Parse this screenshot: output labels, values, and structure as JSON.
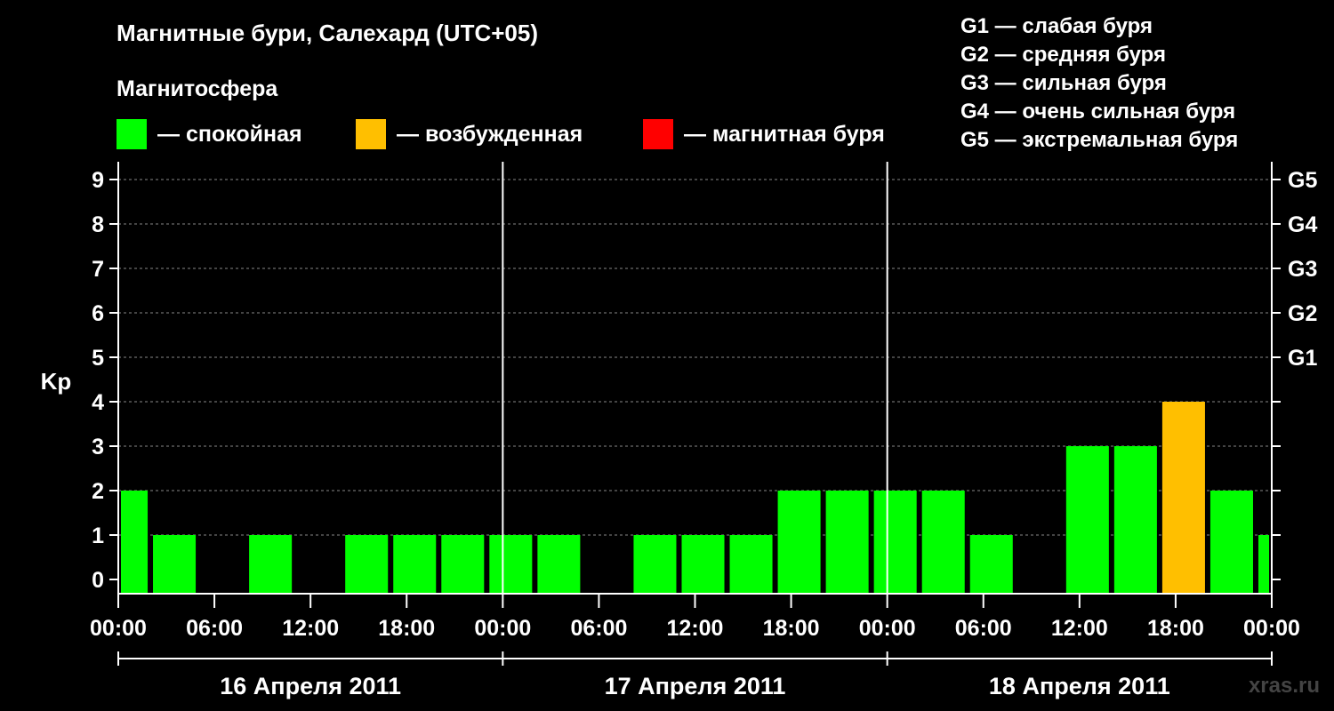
{
  "title": "Магнитные бури, Салехард (UTC+05)",
  "subtitle": "Магнитосфера",
  "legend": [
    {
      "color": "#00ff00",
      "label": "— спокойная"
    },
    {
      "color": "#ffbf00",
      "label": "— возбужденная"
    },
    {
      "color": "#ff0000",
      "label": "— магнитная буря"
    }
  ],
  "storm_scale": [
    "G1 — слабая буря",
    "G2 — средняя буря",
    "G3 — сильная буря",
    "G4 — очень сильная буря",
    "G5 — экстремальная буря"
  ],
  "watermark": "xras.ru",
  "chart_data": {
    "type": "bar",
    "ylabel": "Kp",
    "ylim": [
      0,
      9
    ],
    "yticks": [
      "0",
      "1",
      "2",
      "3",
      "4",
      "5",
      "6",
      "7",
      "8",
      "9"
    ],
    "g_levels": [
      {
        "value": 5,
        "label": "G1"
      },
      {
        "value": 6,
        "label": "G2"
      },
      {
        "value": 7,
        "label": "G3"
      },
      {
        "value": 8,
        "label": "G4"
      },
      {
        "value": 9,
        "label": "G5"
      }
    ],
    "xlim_hours": [
      0,
      72
    ],
    "xticks": [
      "00:00",
      "06:00",
      "12:00",
      "18:00",
      "00:00",
      "06:00",
      "12:00",
      "18:00",
      "00:00",
      "06:00",
      "12:00",
      "18:00",
      "00:00"
    ],
    "days": [
      "16 Апреля 2011",
      "17 Апреля 2011",
      "18 Апреля 2011"
    ],
    "bars": [
      {
        "start_hour": 0,
        "end_hour": 2,
        "kp": 2,
        "color": "#00ff00"
      },
      {
        "start_hour": 2,
        "end_hour": 5,
        "kp": 1,
        "color": "#00ff00"
      },
      {
        "start_hour": 5,
        "end_hour": 8,
        "kp": 0,
        "color": "#00ff00"
      },
      {
        "start_hour": 8,
        "end_hour": 11,
        "kp": 1,
        "color": "#00ff00"
      },
      {
        "start_hour": 11,
        "end_hour": 14,
        "kp": 0,
        "color": "#00ff00"
      },
      {
        "start_hour": 14,
        "end_hour": 17,
        "kp": 1,
        "color": "#00ff00"
      },
      {
        "start_hour": 17,
        "end_hour": 20,
        "kp": 1,
        "color": "#00ff00"
      },
      {
        "start_hour": 20,
        "end_hour": 23,
        "kp": 1,
        "color": "#00ff00"
      },
      {
        "start_hour": 23,
        "end_hour": 26,
        "kp": 1,
        "color": "#00ff00"
      },
      {
        "start_hour": 26,
        "end_hour": 29,
        "kp": 1,
        "color": "#00ff00"
      },
      {
        "start_hour": 29,
        "end_hour": 32,
        "kp": 0,
        "color": "#00ff00"
      },
      {
        "start_hour": 32,
        "end_hour": 35,
        "kp": 1,
        "color": "#00ff00"
      },
      {
        "start_hour": 35,
        "end_hour": 38,
        "kp": 1,
        "color": "#00ff00"
      },
      {
        "start_hour": 38,
        "end_hour": 41,
        "kp": 1,
        "color": "#00ff00"
      },
      {
        "start_hour": 41,
        "end_hour": 44,
        "kp": 2,
        "color": "#00ff00"
      },
      {
        "start_hour": 44,
        "end_hour": 47,
        "kp": 2,
        "color": "#00ff00"
      },
      {
        "start_hour": 47,
        "end_hour": 50,
        "kp": 2,
        "color": "#00ff00"
      },
      {
        "start_hour": 50,
        "end_hour": 53,
        "kp": 2,
        "color": "#00ff00"
      },
      {
        "start_hour": 53,
        "end_hour": 56,
        "kp": 1,
        "color": "#00ff00"
      },
      {
        "start_hour": 56,
        "end_hour": 59,
        "kp": 0,
        "color": "#00ff00"
      },
      {
        "start_hour": 59,
        "end_hour": 62,
        "kp": 3,
        "color": "#00ff00"
      },
      {
        "start_hour": 62,
        "end_hour": 65,
        "kp": 3,
        "color": "#00ff00"
      },
      {
        "start_hour": 65,
        "end_hour": 68,
        "kp": 4,
        "color": "#ffbf00"
      },
      {
        "start_hour": 68,
        "end_hour": 71,
        "kp": 2,
        "color": "#00ff00"
      },
      {
        "start_hour": 71,
        "end_hour": 72,
        "kp": 1,
        "color": "#00ff00"
      }
    ],
    "grid": "dashed horizontal at each Kp level"
  }
}
